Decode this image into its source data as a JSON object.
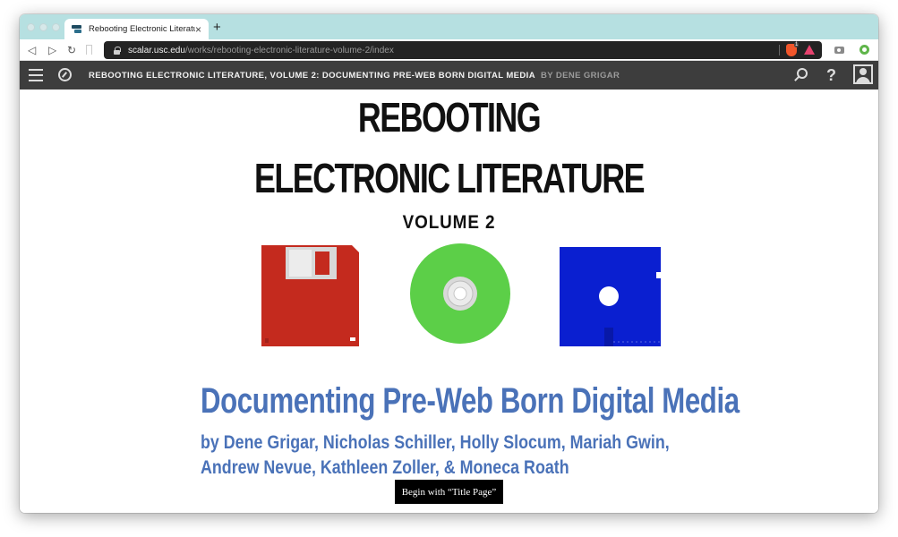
{
  "browser": {
    "tab_title": "Rebooting Electronic Literature",
    "tab_close": "×",
    "new_tab": "+",
    "back": "◁",
    "forward": "▷",
    "reload": "↻",
    "url_domain": "scalar.usc.edu",
    "url_path": "/works/rebooting-electronic-literature-volume-2/index",
    "brave_badge": "1"
  },
  "appbar": {
    "title": "REBOOTING ELECTRONIC LITERATURE, VOLUME 2: DOCUMENTING PRE-WEB BORN DIGITAL MEDIA",
    "author": "BY DENE GRIGAR",
    "help": "?"
  },
  "cover": {
    "line1": "REBOOTING",
    "line2": "ELECTRONIC LITERATURE",
    "line3": "VOLUME 2"
  },
  "main": {
    "subtitle": "Documenting Pre-Web Born Digital Media",
    "byline_1": "by Dene Grigar, Nicholas Schiller, Holly Slocum, Mariah Gwin,",
    "byline_2": "Andrew Nevue, Kathleen Zoller, & Moneca Roath",
    "begin_button": "Begin with “Title Page”"
  },
  "colors": {
    "tab_strip": "#b6e0e1",
    "appbar": "#3d3d3d",
    "subtitle_blue": "#4a72b8",
    "floppy_red": "#c42a1e",
    "cd_green": "#5ccf48",
    "disk_blue": "#0a1fd0"
  }
}
